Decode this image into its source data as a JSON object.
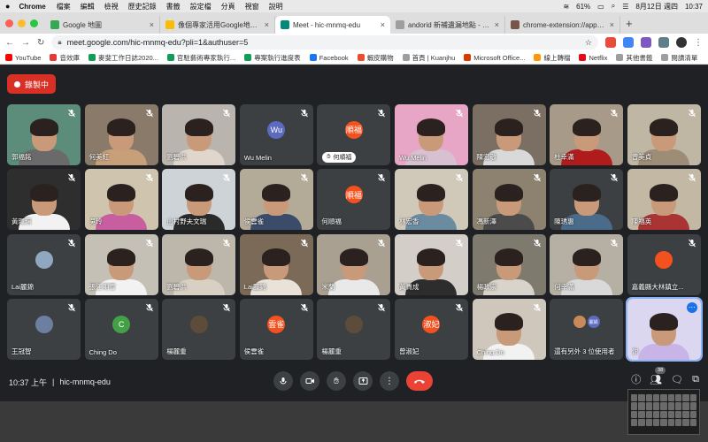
{
  "menubar": {
    "app": "Chrome",
    "items": [
      "檔案",
      "編輯",
      "檢視",
      "歷史記錄",
      "書籤",
      "設定檔",
      "分頁",
      "視窗",
      "說明"
    ],
    "battery": "61%",
    "date": "8月12日 週四",
    "time": "10:37"
  },
  "tabs": [
    {
      "label": "Google 地圖",
      "color": "#34a853"
    },
    {
      "label": "像個專家活用Google地圖App",
      "color": "#fbbc04"
    },
    {
      "label": "Meet - hic-mnmq-edu",
      "color": "#00897b"
    },
    {
      "label": "andorid 新補遺漏地點 - Googl",
      "color": "#9e9e9e"
    },
    {
      "label": "chrome-extension://appcnhief",
      "color": "#795548"
    }
  ],
  "url": "meet.google.com/hic-mnmq-edu?pli=1&authuser=5",
  "bookmarks": [
    {
      "label": "YouTube",
      "color": "#ff0000"
    },
    {
      "label": "音效庫",
      "color": "#e53935"
    },
    {
      "label": "麥斐工作日誌2020...",
      "color": "#0f9d58"
    },
    {
      "label": "官駐藝術專家執行...",
      "color": "#0f9d58"
    },
    {
      "label": "專案執行進度表",
      "color": "#0f9d58"
    },
    {
      "label": "Facebook",
      "color": "#1877f2"
    },
    {
      "label": "蝦皮購物",
      "color": "#ee4d2d"
    },
    {
      "label": "首頁 | Kuanjhu",
      "color": "#9e9e9e"
    },
    {
      "label": "Microsoft Office...",
      "color": "#d83b01"
    },
    {
      "label": "線上轉檔",
      "color": "#ff9800"
    },
    {
      "label": "Netflix",
      "color": "#e50914"
    },
    {
      "label": "其他書籤",
      "color": "#9e9e9e"
    },
    {
      "label": "閱讀清單",
      "color": "#9e9e9e"
    }
  ],
  "record_label": "錄製中",
  "participants": [
    {
      "name": "郭福銘",
      "kind": "video",
      "bg": "#5c8c7a",
      "sh": "#6a6a6a"
    },
    {
      "name": "何美紅",
      "kind": "video",
      "bg": "#8a7a6a",
      "sh": "#c7a07a"
    },
    {
      "name": "劉碧洪",
      "kind": "video",
      "bg": "#b9b4ad",
      "sh": "#e0d6cc"
    },
    {
      "name": "Wu Melin",
      "kind": "avatar",
      "initial": "Wu",
      "color": "#5c6bc0"
    },
    {
      "name": "何順福",
      "kind": "avatar",
      "initial": "順福",
      "color": "#f4511e",
      "hand": true
    },
    {
      "name": "Wu Melin",
      "kind": "video",
      "bg": "#e8a6c6",
      "sh": "#d7c0cf"
    },
    {
      "name": "陳宏敬",
      "kind": "video",
      "bg": "#7a6f62",
      "sh": "#d9d9d9"
    },
    {
      "name": "杜幸滿",
      "kind": "video",
      "bg": "#a89a88",
      "sh": "#b01c1c"
    },
    {
      "name": "曾美貞",
      "kind": "video",
      "bg": "#bfb6a4",
      "sh": "#9d8c76"
    },
    {
      "name": "黃珮琪",
      "kind": "video",
      "bg": "#2e2e2e",
      "sh": "#f2f2f2"
    },
    {
      "name": "吳玲",
      "kind": "video",
      "bg": "#cfc5ae",
      "sh": "#c85ea0"
    },
    {
      "name": "山村野夫文瑞",
      "kind": "video",
      "bg": "#cdd3d6",
      "sh": "#2a2a2a"
    },
    {
      "name": "侯雲雀",
      "kind": "video",
      "bg": "#b4aa98",
      "sh": "#3a4c6a"
    },
    {
      "name": "何順福",
      "kind": "avatar",
      "initial": "順福",
      "color": "#f4511e"
    },
    {
      "name": "林宏香",
      "kind": "video",
      "bg": "#d0c8b9",
      "sh": "#6b8ba0"
    },
    {
      "name": "馮新澤",
      "kind": "video",
      "bg": "#8d8270",
      "sh": "#4b4b4b"
    },
    {
      "name": "陳琇惠",
      "kind": "video",
      "bg": "#3c4043",
      "sh": "#4a6b8a"
    },
    {
      "name": "陳福英",
      "kind": "video",
      "bg": "#c2b8a4",
      "sh": "#a33"
    },
    {
      "name": "Lai麗錦",
      "kind": "avatar",
      "initial": "",
      "color": "#8fa8c0"
    },
    {
      "name": "張江明雪",
      "kind": "video",
      "bg": "#c5c0b6",
      "sh": "#f2f2f2"
    },
    {
      "name": "劉碧洪",
      "kind": "video",
      "bg": "#bdb7ab",
      "sh": "#d9d0c4"
    },
    {
      "name": "Lai麗錦",
      "kind": "video",
      "bg": "#7b6a57",
      "sh": "#e8e2d8"
    },
    {
      "name": "米蘭",
      "kind": "video",
      "bg": "#a9a091",
      "sh": "#e9e9e9"
    },
    {
      "name": "黃貴成",
      "kind": "video",
      "bg": "#d3cec7",
      "sh": "#2d2d2d"
    },
    {
      "name": "楊政崇",
      "kind": "video",
      "bg": "#7f7a6e",
      "sh": "#d8d4cb"
    },
    {
      "name": "何幸滿",
      "kind": "video",
      "bg": "#b5b0a3",
      "sh": "#d9d9d9"
    },
    {
      "name": "嘉義縣大林鎮立...",
      "kind": "avatar",
      "initial": "",
      "color": "#f4511e"
    },
    {
      "name": "王冠智",
      "kind": "avatar",
      "initial": "",
      "color": "#6d7fa0"
    },
    {
      "name": "Ching Do",
      "kind": "avatar",
      "initial": "C",
      "color": "#43a047"
    },
    {
      "name": "楊麗重",
      "kind": "avatar",
      "initial": "",
      "color": "#5d4c3a"
    },
    {
      "name": "侯雲雀",
      "kind": "avatar",
      "initial": "雲雀",
      "color": "#f4511e"
    },
    {
      "name": "楊麗重",
      "kind": "avatar",
      "initial": "",
      "color": "#5d4c3a"
    },
    {
      "name": "曾淑妃",
      "kind": "avatar",
      "initial": "淑妃",
      "color": "#f4511e"
    },
    {
      "name": "Ching Do",
      "kind": "video",
      "bg": "#cfc7bb",
      "sh": "#f2f2f2"
    },
    {
      "name": "還有另外 3 位使用者",
      "kind": "others",
      "initial": "麗娟",
      "color": "#5c6bc0"
    },
    {
      "name": "你",
      "kind": "video",
      "bg": "#dcd7f0",
      "sh": "#c8b4e6",
      "self": true
    }
  ],
  "bottom": {
    "time": "10:37 上午",
    "meeting_code": "hic-mnmq-edu",
    "people_count": "38"
  }
}
